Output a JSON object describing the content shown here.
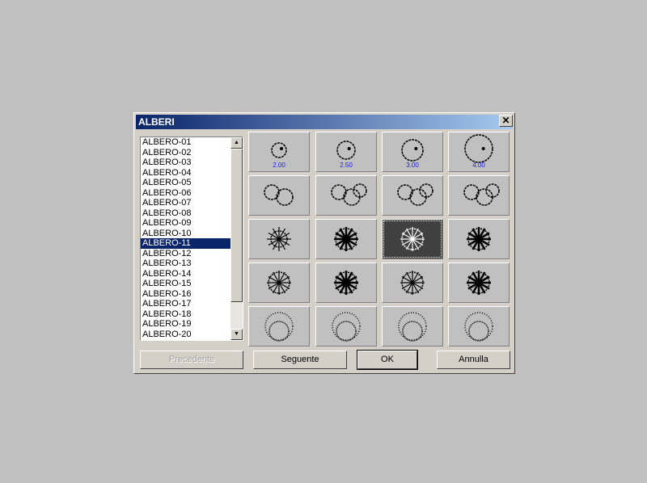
{
  "title": "ALBERI",
  "close_label": "✕",
  "list": {
    "items": [
      "ALBERO-01",
      "ALBERO-02",
      "ALBERO-03",
      "ALBERO-04",
      "ALBERO-05",
      "ALBERO-06",
      "ALBERO-07",
      "ALBERO-08",
      "ALBERO-09",
      "ALBERO-10",
      "ALBERO-11",
      "ALBERO-12",
      "ALBERO-13",
      "ALBERO-14",
      "ALBERO-15",
      "ALBERO-16",
      "ALBERO-17",
      "ALBERO-18",
      "ALBERO-19",
      "ALBERO-20"
    ],
    "selected_index": 10
  },
  "grid": {
    "size_labels": [
      "2.00",
      "2.50",
      "3.00",
      "4.00"
    ],
    "selected_cell": 10
  },
  "buttons": {
    "previous": "Precedente",
    "next": "Seguente",
    "ok": "OK",
    "cancel": "Annulla"
  },
  "colors": {
    "title_start": "#0a246a",
    "title_end": "#a6caf0",
    "selection": "#0a246a",
    "size_label": "#2020e0"
  }
}
